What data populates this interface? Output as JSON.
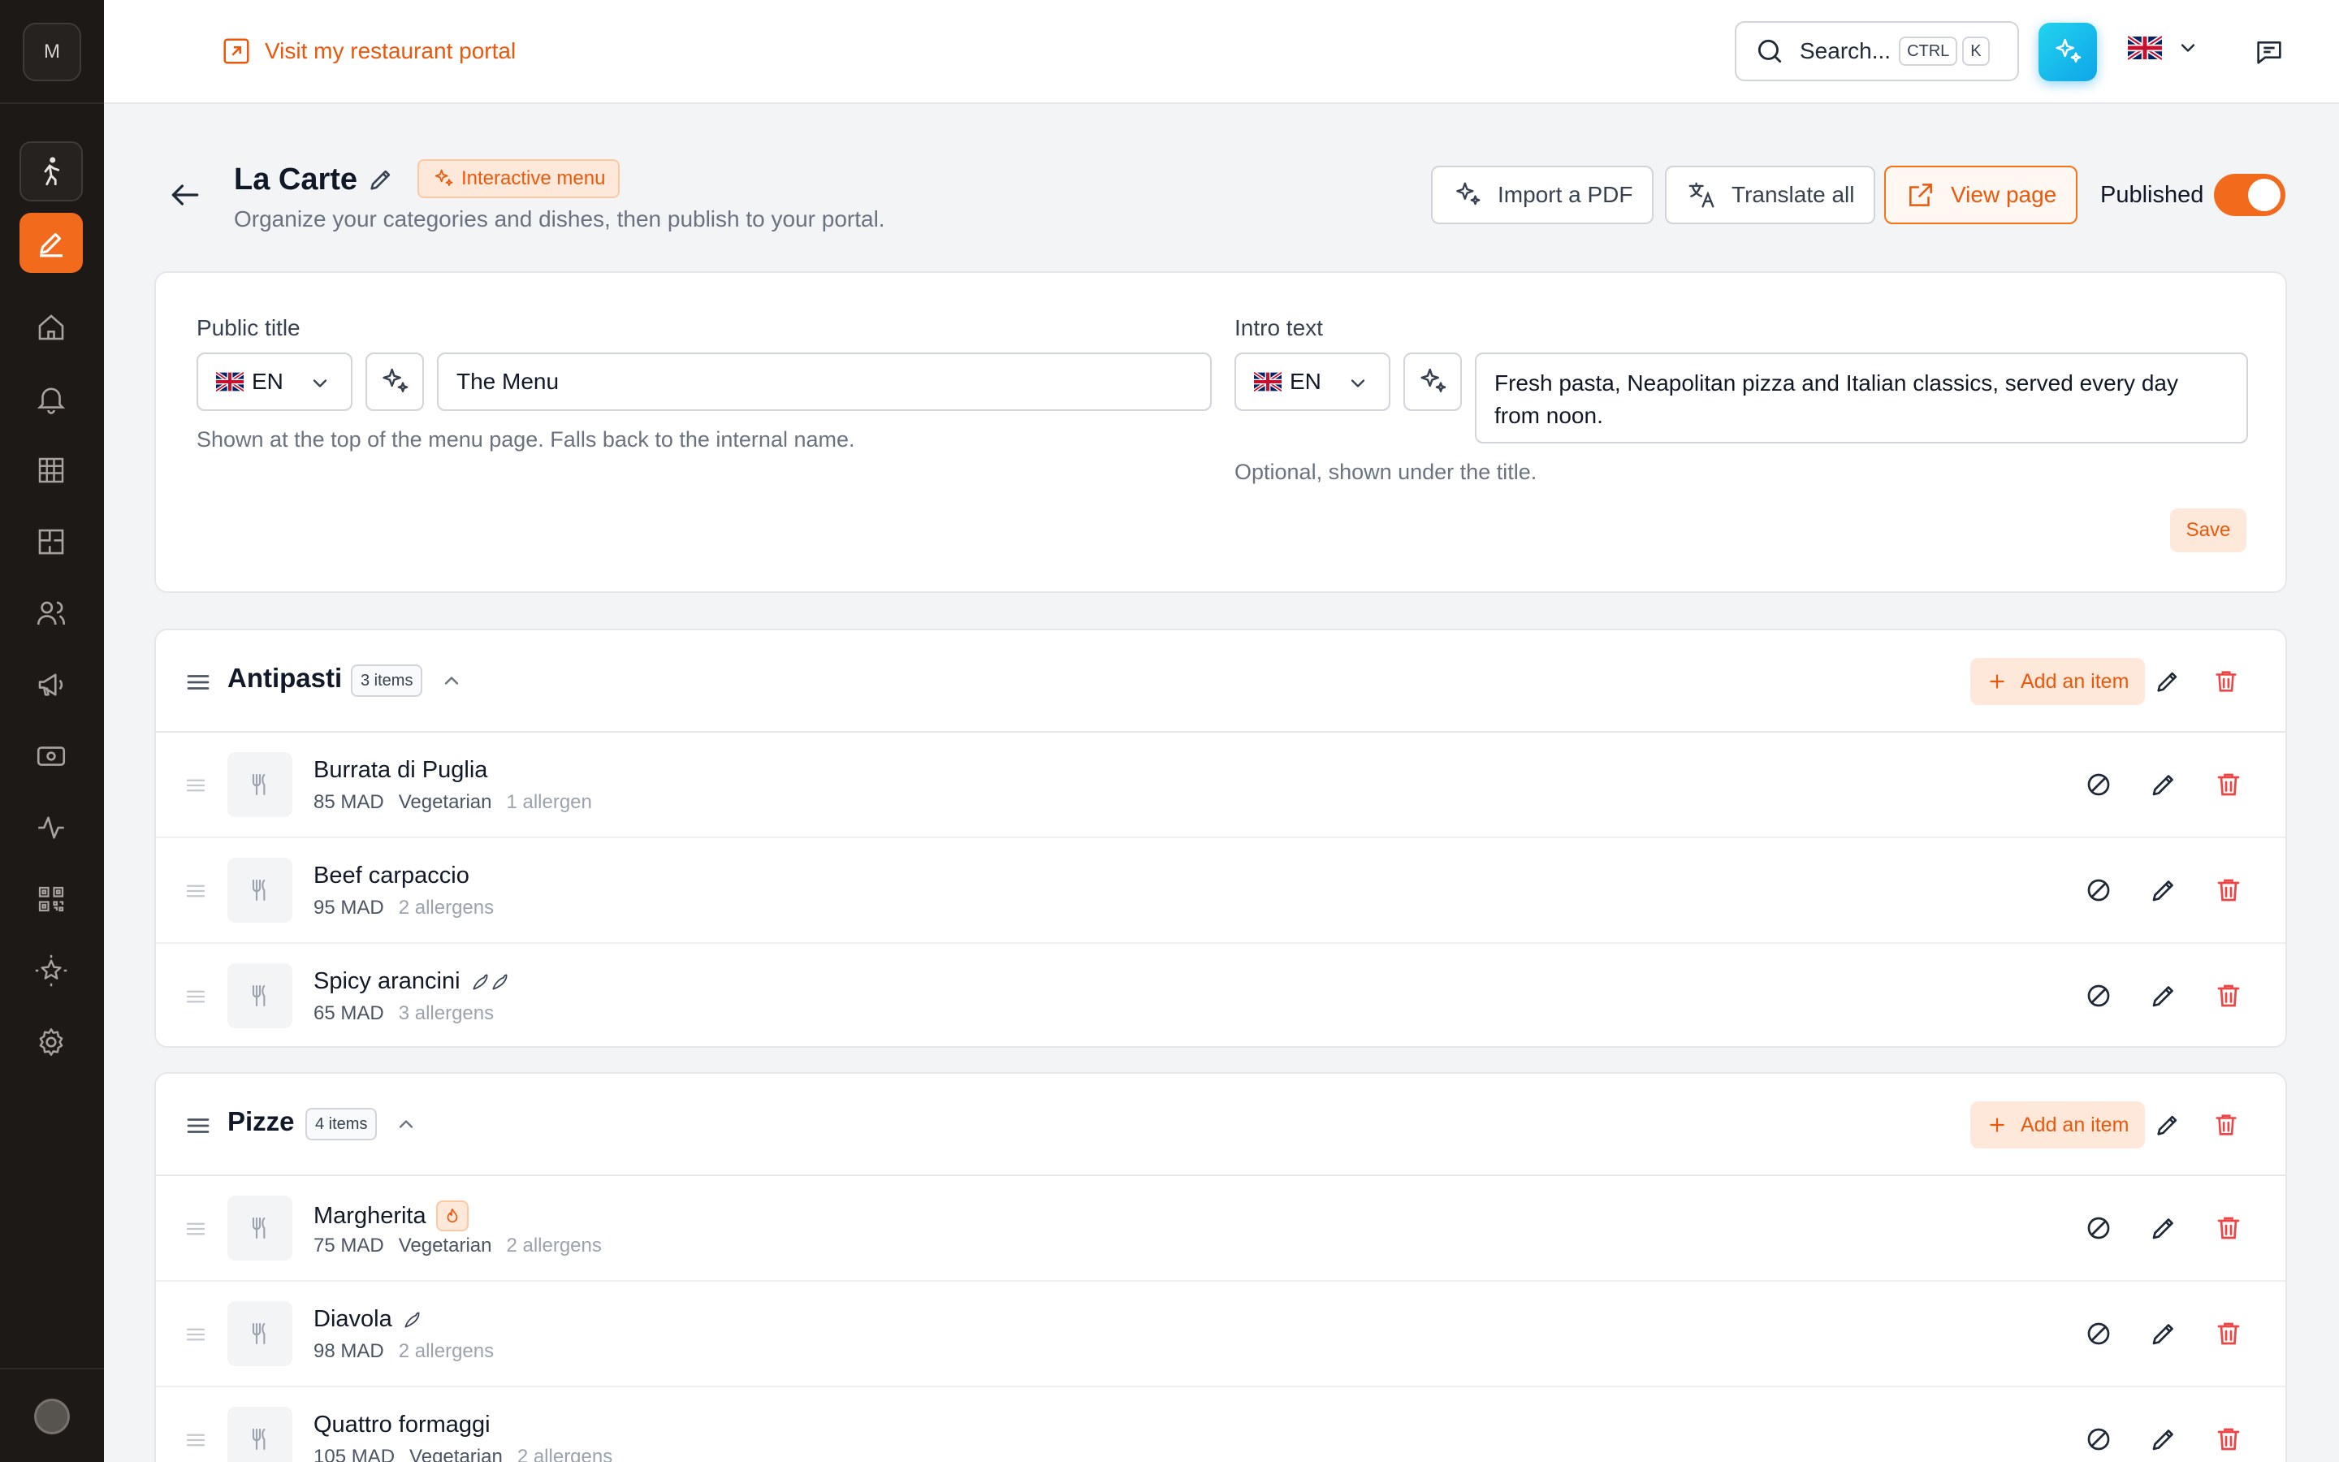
{
  "sidebar": {
    "logo_letter": "M"
  },
  "topbar": {
    "portal_link": "Visit my restaurant portal",
    "search_placeholder": "Search...",
    "kbd_ctrl": "CTRL",
    "kbd_k": "K"
  },
  "header": {
    "title": "La Carte",
    "badge": "Interactive menu",
    "subtitle": "Organize your categories and dishes, then publish to your portal.",
    "import_label": "Import a PDF",
    "translate_label": "Translate all",
    "view_label": "View page",
    "published_label": "Published",
    "published": true
  },
  "settings": {
    "public_title_label": "Public title",
    "public_title_lang": "EN",
    "public_title_value": "The Menu",
    "public_title_help": "Shown at the top of the menu page. Falls back to the internal name.",
    "intro_label": "Intro text",
    "intro_lang": "EN",
    "intro_value": "Fresh pasta, Neapolitan pizza and Italian classics, served every day from noon.",
    "intro_help": "Optional, shown under the title.",
    "save_label": "Save"
  },
  "categories": [
    {
      "name": "Antipasti",
      "count": "3 items",
      "add_label": "Add an item",
      "items": [
        {
          "name": "Burrata di Puglia",
          "price": "85 MAD",
          "tag": "Vegetarian",
          "allergens": "1 allergen"
        },
        {
          "name": "Beef carpaccio",
          "price": "95 MAD",
          "tag": "",
          "allergens": "2 allergens"
        },
        {
          "name": "Spicy arancini",
          "price": "65 MAD",
          "tag": "",
          "allergens": "3 allergens"
        }
      ]
    },
    {
      "name": "Pizze",
      "count": "4 items",
      "add_label": "Add an item",
      "items": [
        {
          "name": "Margherita",
          "price": "75 MAD",
          "tag": "Vegetarian",
          "allergens": "2 allergens"
        },
        {
          "name": "Diavola",
          "price": "98 MAD",
          "tag": "",
          "allergens": "2 allergens"
        },
        {
          "name": "Quattro formaggi",
          "price": "105 MAD",
          "tag": "Vegetarian",
          "allergens": "2 allergens"
        }
      ]
    }
  ],
  "colors": {
    "accent": "#f26b1d",
    "sidebar": "#1c1917",
    "danger": "#ef4444"
  }
}
